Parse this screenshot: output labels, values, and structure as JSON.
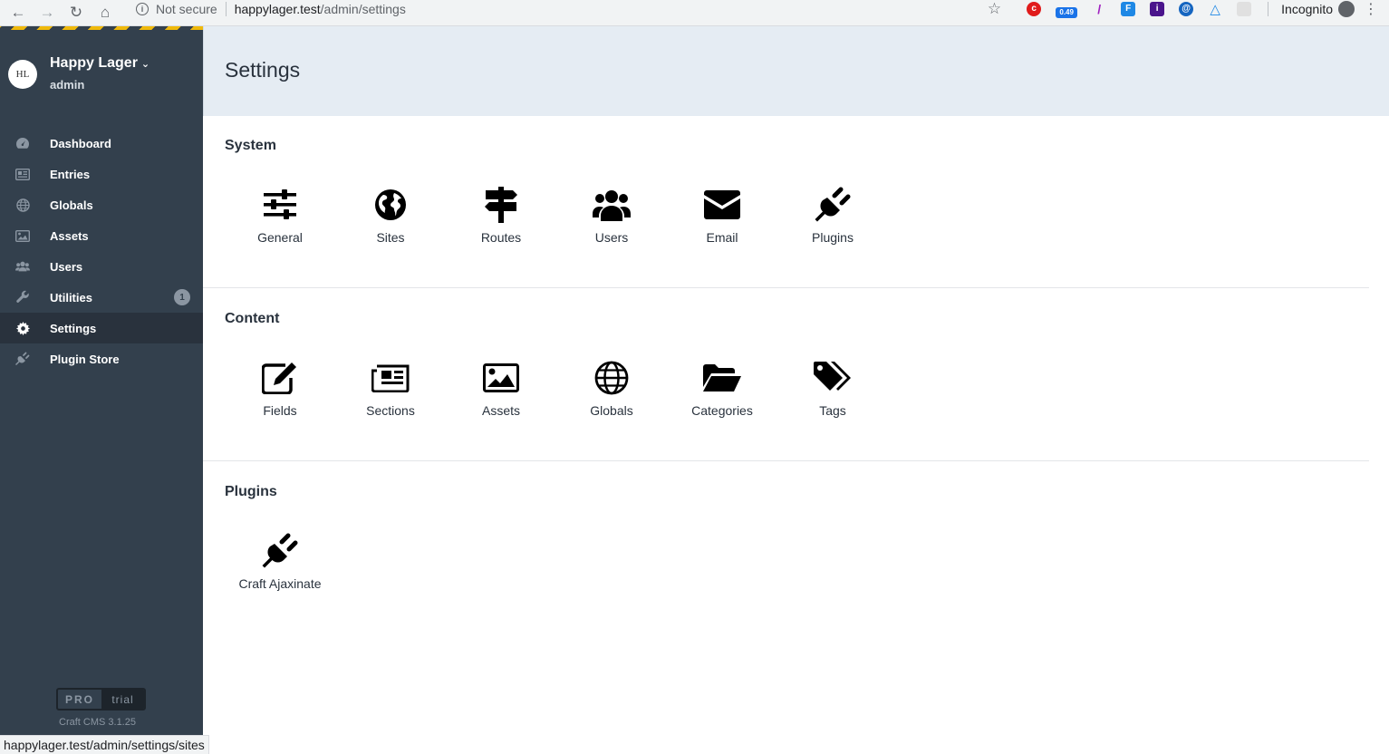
{
  "browser": {
    "back": "←",
    "forward": "→",
    "reload": "↻",
    "home": "⌂",
    "security_label": "Not secure",
    "url_host": "happylager.test",
    "url_path": "/admin/settings",
    "star": "☆",
    "ext_badge": "0.49",
    "incognito_label": "Incognito",
    "menu": "⋮"
  },
  "sidebar": {
    "site_logo": "HL",
    "site_name": "Happy Lager",
    "site_user": "admin",
    "items": [
      {
        "label": "Dashboard",
        "icon": "dashboard-icon"
      },
      {
        "label": "Entries",
        "icon": "entries-icon"
      },
      {
        "label": "Globals",
        "icon": "globe-icon"
      },
      {
        "label": "Assets",
        "icon": "image-icon"
      },
      {
        "label": "Users",
        "icon": "users-icon"
      },
      {
        "label": "Utilities",
        "icon": "wrench-icon",
        "badge": "1"
      },
      {
        "label": "Settings",
        "icon": "gear-icon",
        "active": true
      },
      {
        "label": "Plugin Store",
        "icon": "plug-icon"
      }
    ],
    "edition": "PRO",
    "edition_status": "trial",
    "version": "Craft CMS 3.1.25"
  },
  "main": {
    "title": "Settings",
    "sections": [
      {
        "title": "System",
        "items": [
          {
            "label": "General",
            "icon": "sliders-icon"
          },
          {
            "label": "Sites",
            "icon": "earth-icon"
          },
          {
            "label": "Routes",
            "icon": "signpost-icon"
          },
          {
            "label": "Users",
            "icon": "users-icon"
          },
          {
            "label": "Email",
            "icon": "envelope-icon"
          },
          {
            "label": "Plugins",
            "icon": "plug-icon"
          }
        ]
      },
      {
        "title": "Content",
        "items": [
          {
            "label": "Fields",
            "icon": "edit-icon"
          },
          {
            "label": "Sections",
            "icon": "newspaper-icon"
          },
          {
            "label": "Assets",
            "icon": "image-icon"
          },
          {
            "label": "Globals",
            "icon": "globe-icon"
          },
          {
            "label": "Categories",
            "icon": "folder-open-icon"
          },
          {
            "label": "Tags",
            "icon": "tags-icon"
          }
        ]
      },
      {
        "title": "Plugins",
        "items": [
          {
            "label": "Craft Ajaxinate",
            "icon": "plug-icon"
          }
        ]
      }
    ]
  },
  "status_bar_url": "happylager.test/admin/settings/sites",
  "colors": {
    "sidebar_bg": "#33404d",
    "header_bg": "#e5ecf3",
    "active_bg": "#29323d",
    "stripe": "#f0b90b"
  }
}
